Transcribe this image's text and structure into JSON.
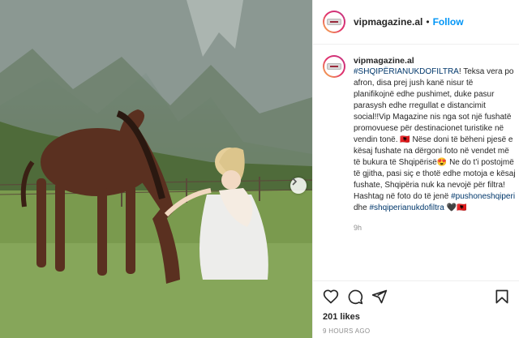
{
  "header": {
    "username": "vipmagazine.al",
    "separator": "•",
    "follow_label": "Follow"
  },
  "caption": {
    "username": "vipmagazine.al",
    "hashtag_main": "#SHQIPËRIANUKDOFILTRA",
    "text_1": "! Teksa vera po afron, disa prej jush kanë nisur të planifikojnë edhe pushimet, duke pasur parasysh edhe rregullat e distancimit social!!Vip Magazine nis nga sot një fushatë promovuese për destinacionet turistike në vendin tonë. 🇦🇱 Nëse doni të bëheni pjesë e kësaj fushate na dërgoni foto në vendet më të bukura të Shqipërisë😍 Ne do t'i postojmë të gjitha, pasi siç e thotë edhe motoja e kësaj fushate, Shqipëria nuk ka nevojë për filtra! Hashtag në foto do të jenë ",
    "hashtag_1": "#pushoneshqiperi",
    "text_2": " dhe ",
    "hashtag_2": "#shqiperianukdofiltra",
    "text_3": " 🖤🇦🇱",
    "time": "9h"
  },
  "footer": {
    "likes": "201 likes",
    "posted": "9 HOURS AGO"
  },
  "icons": {
    "like": "heart-icon",
    "comment": "comment-icon",
    "share": "share-icon",
    "save": "bookmark-icon",
    "carousel": "chevron-right-icon"
  },
  "colors": {
    "link": "#0095f6",
    "hashtag": "#00376b",
    "muted": "#8e8e8e"
  }
}
